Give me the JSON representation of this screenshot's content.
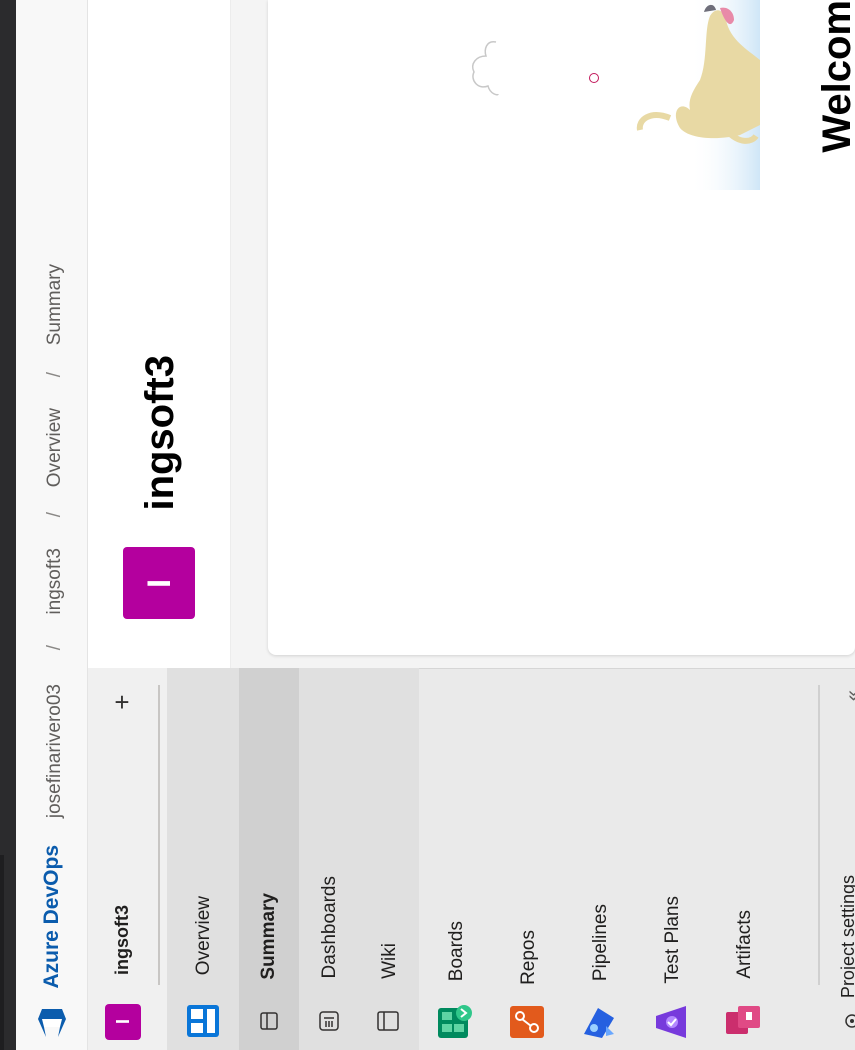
{
  "header": {
    "brand": "Azure DevOps",
    "breadcrumb": [
      "josefinarivero03",
      "ingsoft3",
      "Overview",
      "Summary"
    ],
    "separator": "/"
  },
  "project": {
    "name": "ingsoft3",
    "avatar_letter": "I",
    "color": "#b4009e"
  },
  "content": {
    "welcome": "Welcom"
  },
  "nav": {
    "add_icon": "plus-icon",
    "project_name": "ingsoft3",
    "items": [
      {
        "label": "Overview",
        "icon": "overview-icon"
      },
      {
        "label": "Summary",
        "icon": "summary-icon"
      },
      {
        "label": "Dashboards",
        "icon": "dashboards-icon"
      },
      {
        "label": "Wiki",
        "icon": "wiki-icon"
      },
      {
        "label": "Boards",
        "icon": "boards-icon"
      },
      {
        "label": "Repos",
        "icon": "repos-icon"
      },
      {
        "label": "Pipelines",
        "icon": "pipelines-icon"
      },
      {
        "label": "Test Plans",
        "icon": "test-plans-icon"
      },
      {
        "label": "Artifacts",
        "icon": "artifacts-icon"
      }
    ],
    "settings_label": "Project settings",
    "collapse_icon": "chevron-double-icon"
  },
  "colors": {
    "accent": "#0b5cad",
    "project": "#b4009e"
  }
}
